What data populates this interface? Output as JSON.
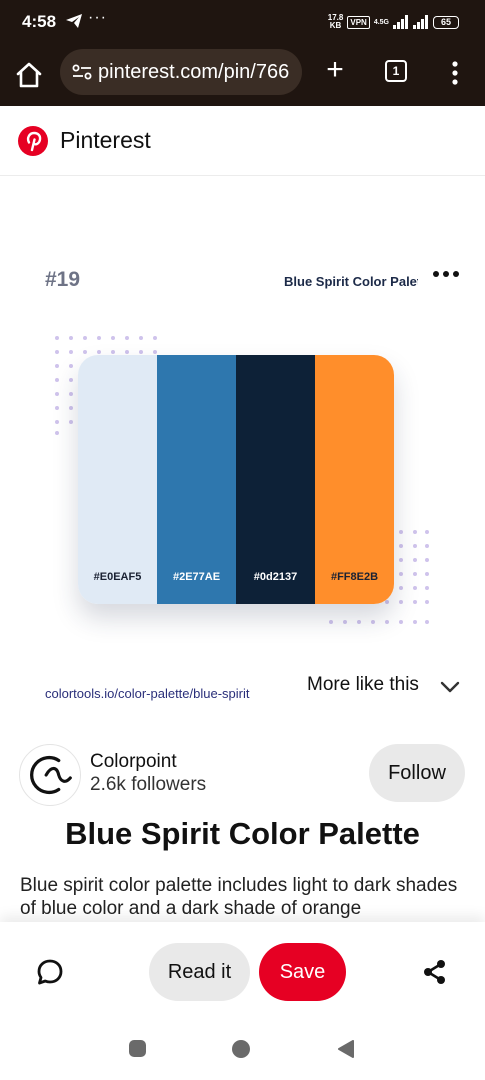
{
  "status_bar": {
    "time": "4:58",
    "more": "···",
    "net_speed_value": "17.8",
    "net_speed_unit": "KB",
    "vpn": "VPN",
    "network": "4.5G",
    "battery": "65"
  },
  "browser": {
    "url": "pinterest.com/pin/766",
    "new_tab": "+",
    "tab_count": "1"
  },
  "pinterest": {
    "brand": "Pinterest"
  },
  "image": {
    "number": "#19",
    "title": "Blue Spirit Color Palette",
    "swatches": [
      {
        "code": "#E0EAF5",
        "color": "#E0EAF5",
        "text_color": "#1b2233"
      },
      {
        "code": "#2E77AE",
        "color": "#2E77AE",
        "text_color": "#ffffff"
      },
      {
        "code": "#0d2137",
        "color": "#0d2137",
        "text_color": "#ffffff"
      },
      {
        "code": "#FF8E2B",
        "color": "#FF8E2B",
        "text_color": "#1b2233"
      }
    ]
  },
  "source_link": "colortools.io/color-palette/blue-spirit",
  "more_like_this": "More like this",
  "creator": {
    "name": "Colorpoint",
    "followers": "2.6k followers",
    "follow_label": "Follow"
  },
  "pin": {
    "title": "Blue Spirit Color Palette",
    "description": "Blue spirit color palette includes light to dark shades of blue color and a dark shade of orange"
  },
  "actions": {
    "read_label": "Read it",
    "save_label": "Save"
  },
  "colors": {
    "pinterest_red": "#E60023",
    "browser_bg": "#1F1510"
  }
}
